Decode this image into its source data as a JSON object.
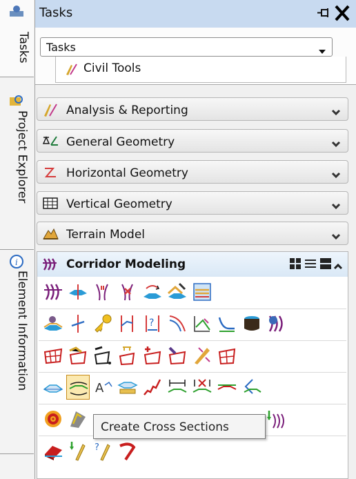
{
  "sidebar": {
    "tasks_label": "Tasks",
    "project_explorer_label": "Project Explorer",
    "element_information_label": "Element Information"
  },
  "header": {
    "title": "Tasks"
  },
  "task_selector": {
    "value": "Tasks",
    "item": "Civil Tools"
  },
  "categories": [
    {
      "label": "Analysis & Reporting",
      "icon": "analysis-icon"
    },
    {
      "label": "General Geometry",
      "icon": "general-geometry-icon"
    },
    {
      "label": "Horizontal Geometry",
      "icon": "horizontal-geometry-icon"
    },
    {
      "label": "Vertical Geometry",
      "icon": "vertical-geometry-icon"
    },
    {
      "label": "Terrain Model",
      "icon": "terrain-model-icon"
    }
  ],
  "corridor": {
    "label": "Corridor Modeling"
  },
  "tooltip": {
    "text": "Create Cross Sections"
  },
  "colors": {
    "header_bg": "#c8daf0",
    "accent_blue": "#1f6fd0",
    "active_tool": "#fbe9b0"
  }
}
